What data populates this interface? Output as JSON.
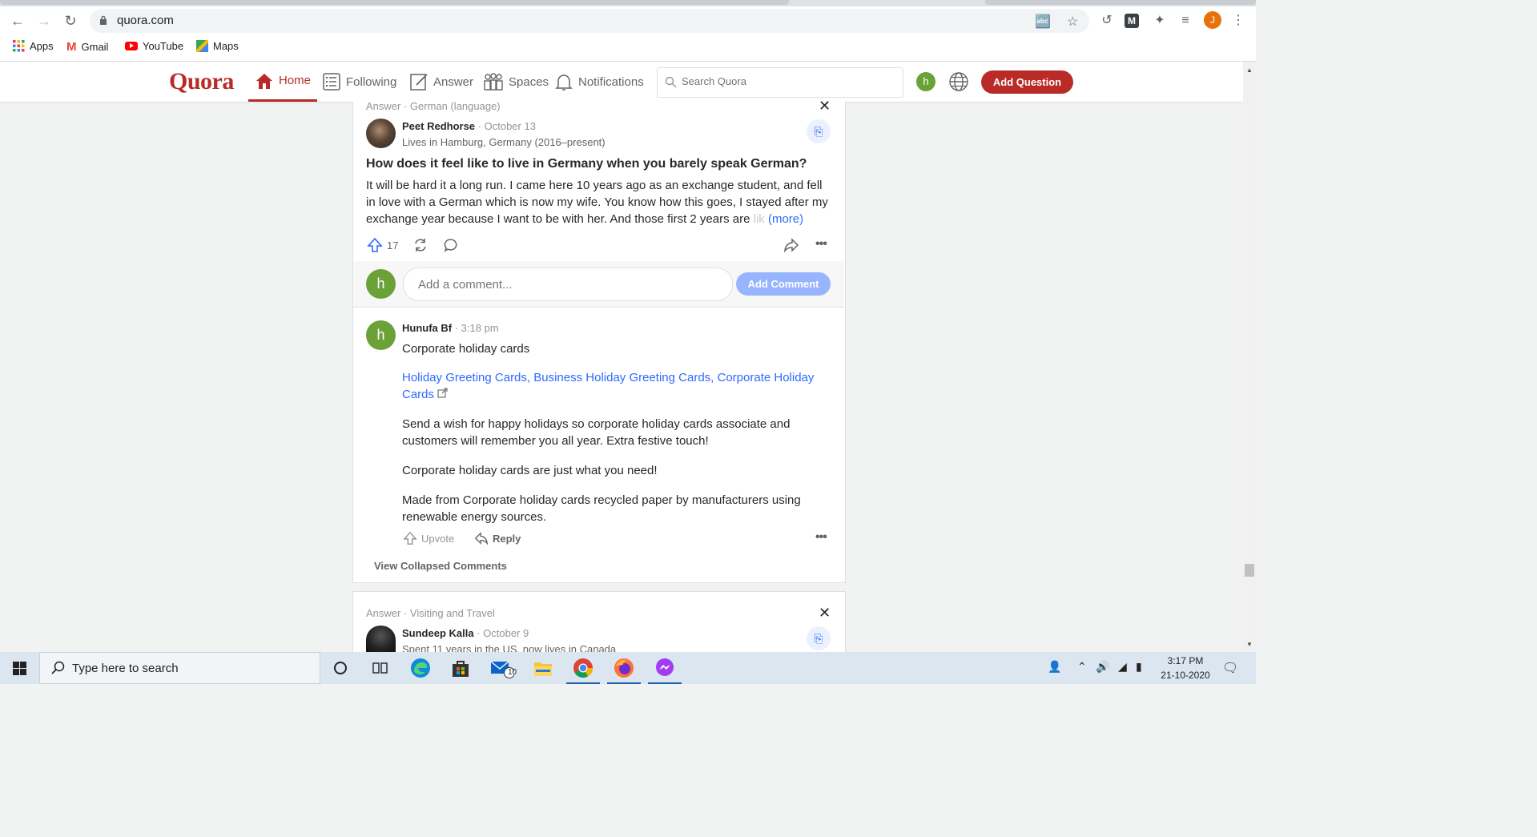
{
  "browser": {
    "url": "quora.com",
    "bookmarks": [
      {
        "label": "Apps",
        "icon": "apps-grid-icon"
      },
      {
        "label": "Gmail",
        "icon": "gmail-icon"
      },
      {
        "label": "YouTube",
        "icon": "youtube-icon"
      },
      {
        "label": "Maps",
        "icon": "maps-icon"
      }
    ],
    "profile_initial": "J"
  },
  "quora": {
    "logo": "Quora",
    "nav": [
      {
        "label": "Home",
        "icon": "home-icon",
        "active": true
      },
      {
        "label": "Following",
        "icon": "following-icon"
      },
      {
        "label": "Answer",
        "icon": "answer-icon"
      },
      {
        "label": "Spaces",
        "icon": "spaces-icon"
      },
      {
        "label": "Notifications",
        "icon": "bell-icon"
      }
    ],
    "search_placeholder": "Search Quora",
    "user_initial": "h",
    "add_question": "Add Question",
    "brand_color": "#b92b27"
  },
  "feed": {
    "card1": {
      "meta": "Answer · German (language)",
      "author": "Peet Redhorse",
      "date": "· October 13",
      "credential": "Lives in Hamburg, Germany (2016–present)",
      "question": "How does it feel like to live in Germany when you barely speak German?",
      "answer_main": "It will be hard it a long run. I came here 10 years ago as an exchange student, and fell in love with a German which is now my wife. You know how this goes, I stayed after my exchange year because I want to be with her. And those first 2 years are ",
      "answer_fade": "lik",
      "more": "(more)",
      "upvotes": "17",
      "comment_placeholder": "Add a comment...",
      "add_comment": "Add Comment",
      "comment": {
        "author_initial": "h",
        "author": "Hunufa Bf",
        "time": "· 3:18 pm",
        "title": "Corporate holiday cards",
        "link": "Holiday Greeting Cards, Business Holiday Greeting Cards, Corporate Holiday Cards",
        "para1": "Send a wish for happy holidays so corporate holiday cards associate and customers will remember you all year. Extra festive touch!",
        "para2": "Corporate holiday cards are just what you need!",
        "para3": "Made from Corporate holiday cards recycled paper by manufacturers using renewable energy sources.",
        "upvote": "Upvote",
        "reply": "Reply"
      },
      "view_collapsed": "View Collapsed Comments"
    },
    "card2": {
      "meta": "Answer · Visiting and Travel",
      "author": "Sundeep Kalla",
      "date": "· October 9",
      "credential": "Spent 11 years in the US, now lives in Canada"
    }
  },
  "taskbar": {
    "search_text": "Type here to search",
    "mail_badge": "10",
    "time": "3:17 PM",
    "date": "21-10-2020"
  }
}
